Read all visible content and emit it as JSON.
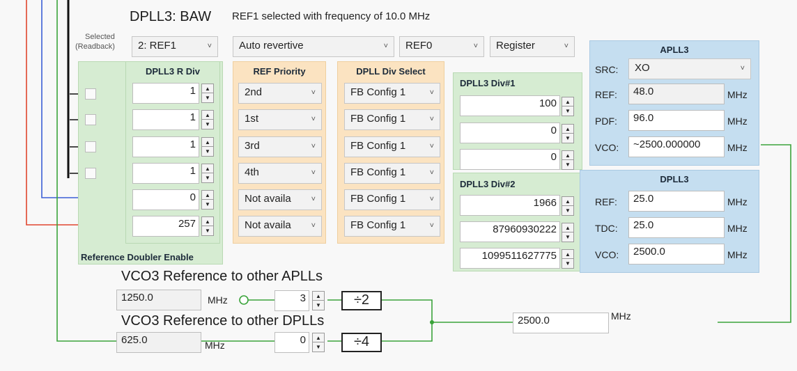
{
  "header": {
    "title": "DPLL3: BAW",
    "status": "REF1 selected with frequency of 10.0 MHz",
    "selected_readback_label": "Selected\n(Readback)"
  },
  "top_controls": {
    "readback_select": "2: REF1",
    "mode_select": "Auto revertive",
    "ref_select": "REF0",
    "register_select": "Register"
  },
  "r_div": {
    "title": "DPLL3 R Div",
    "values": [
      "1",
      "1",
      "1",
      "1",
      "0",
      "257"
    ]
  },
  "ref_priority": {
    "title": "REF Priority",
    "values": [
      "2nd",
      "1st",
      "3rd",
      "4th",
      "Not availa",
      "Not availa"
    ]
  },
  "div_select": {
    "title": "DPLL Div Select",
    "values": [
      "FB Config 1",
      "FB Config 1",
      "FB Config 1",
      "FB Config 1",
      "FB Config 1",
      "FB Config 1"
    ]
  },
  "ref_doubler_label": "Reference Doubler Enable",
  "div1": {
    "title": "DPLL3 Div#1",
    "values": [
      "100",
      "0",
      "0"
    ]
  },
  "div2": {
    "title": "DPLL3 Div#2",
    "values": [
      "1966",
      "87960930222",
      "1099511627775"
    ]
  },
  "apll3": {
    "title": "APLL3",
    "src_label": "SRC:",
    "src_value": "XO",
    "ref_label": "REF:",
    "ref_value": "48.0",
    "pdf_label": "PDF:",
    "pdf_value": "96.0",
    "vco_label": "VCO:",
    "vco_value": "~2500.000000",
    "unit": "MHz"
  },
  "dpll3": {
    "title": "DPLL3",
    "ref_label": "REF:",
    "ref_value": "25.0",
    "tdc_label": "TDC:",
    "tdc_value": "25.0",
    "vco_label": "VCO:",
    "vco_value": "2500.0",
    "unit": "MHz"
  },
  "vco_ref_aplls": {
    "title": "VCO3 Reference to other APLLs",
    "value": "1250.0",
    "unit": "MHz",
    "div_value": "3",
    "divider": "÷2"
  },
  "vco_ref_dplls": {
    "title": "VCO3 Reference to other DPLLs",
    "value": "625.0",
    "unit": "MHz",
    "div_value": "0",
    "divider": "÷4"
  },
  "output": {
    "value": "2500.0",
    "unit": "MHz"
  },
  "colors": {
    "green_line": "#3aa33a",
    "blue_line": "#3a5fd6",
    "red_line": "#e0462f",
    "panel_green": "#d6ecd2",
    "panel_orange": "#fbe3c1",
    "panel_blue": "#c5def0"
  },
  "icons": {
    "dropdown": "chevron-down-icon",
    "spin": "spinner-updown-icon",
    "arrow": "arrow-right-icon"
  }
}
